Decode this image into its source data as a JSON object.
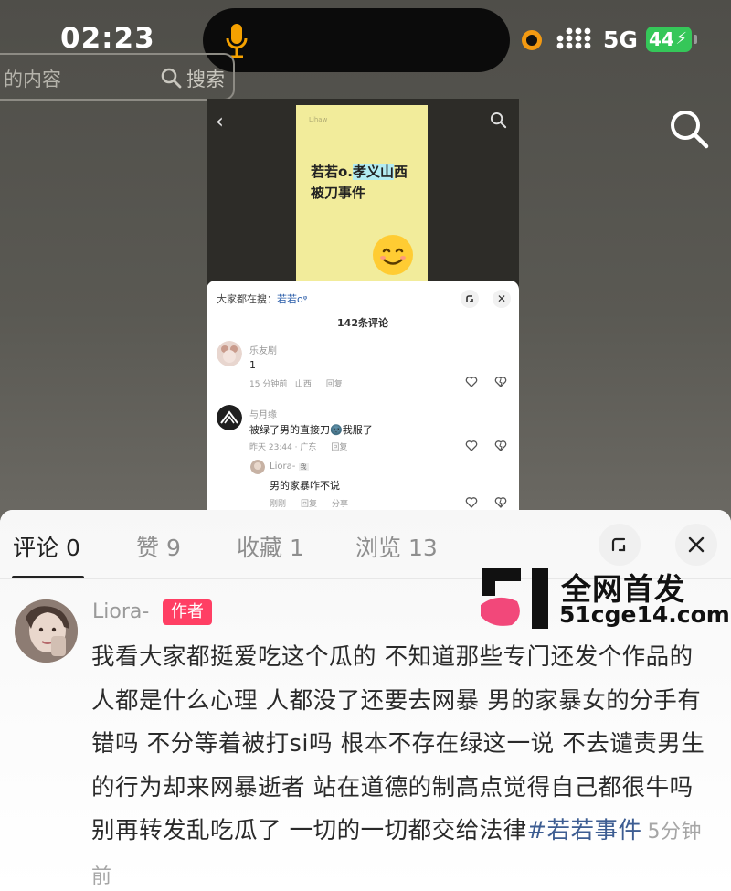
{
  "status_bar": {
    "time": "02:23",
    "network": "5G",
    "battery": "44"
  },
  "background_search": {
    "partial_text": "的内容",
    "button_label": "搜索"
  },
  "inner_screenshot": {
    "card_tag": "Lihaw",
    "card_title_part1": "若若o.",
    "card_title_highlight": "孝义山",
    "card_title_part2": "西被刀事件",
    "search_hint_prefix": "大家都在搜：",
    "search_hint_query": "若若o",
    "comment_count": "142条评论",
    "comments": [
      {
        "user": "乐友剧",
        "text": "1",
        "time": "15 分钟前 · 山西",
        "reply": "回复"
      },
      {
        "user": "与月缘",
        "text": "被绿了男的直接刀🌚我服了",
        "time": "昨天 23:44 · 广东",
        "reply": "回复"
      },
      {
        "user": "Liora-",
        "badge": "我",
        "text": "男的家暴咋不说",
        "time": "刚刚",
        "reply": "回复",
        "share": "分享"
      }
    ]
  },
  "sheet": {
    "tabs": [
      "评论 0",
      "赞 9",
      "收藏 1",
      "浏览 13"
    ],
    "author": {
      "name": "Liora-",
      "badge": "作者"
    },
    "comment_text": "我看大家都挺爱吃这个瓜的 不知道那些专门还发个作品的人都是什么心理 人都没了还要去网暴 男的家暴女的分手有错吗 不分等着被打si吗 根本不存在绿这一说 不去谴责男生的行为却来网暴逝者 站在道德的制高点觉得自己都很牛吗 别再转发乱吃瓜了 一切的一切都交给法律",
    "hashtag": "#若若事件",
    "time_ago": "5分钟前"
  },
  "watermark": {
    "line1": "全网首发",
    "line2": "51cge14.com"
  },
  "colors": {
    "badge": "#ff3f64",
    "hashtag": "#3d5d92",
    "battery": "#35c759",
    "card": "#f2ec9b"
  }
}
